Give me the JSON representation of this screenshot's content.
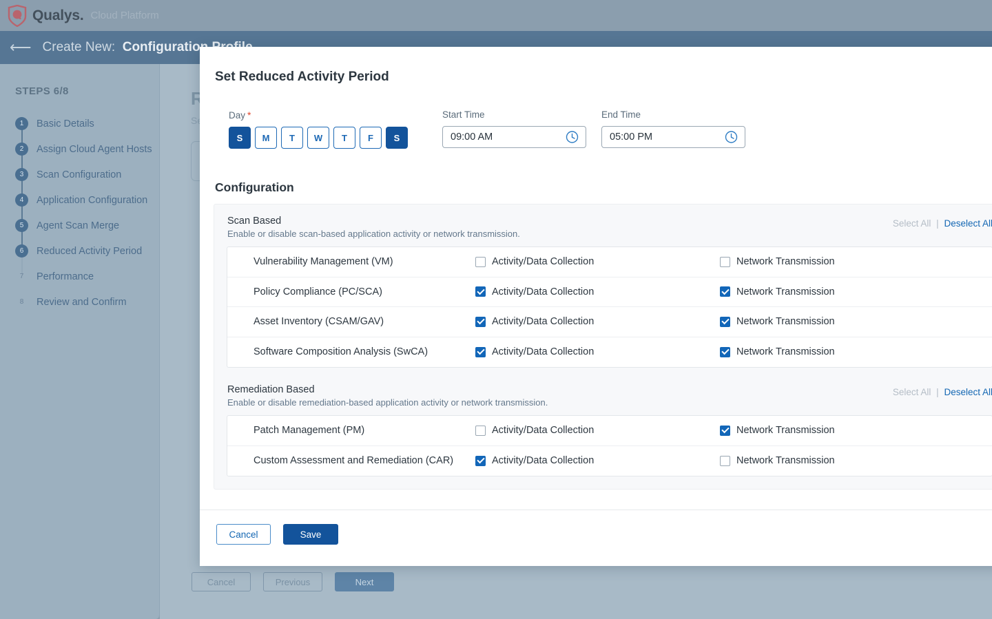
{
  "brand": {
    "name": "Qualys",
    "name_suffix": ".",
    "tagline": "Cloud Platform",
    "logo_icon": "qualys-shield-icon",
    "logo_color": "#b9646d"
  },
  "subheader": {
    "back_icon": "back-arrow-icon",
    "prefix": "Create New:",
    "title": "Configuration Profile"
  },
  "sidebar": {
    "steps_label": "STEPS 6/8",
    "items": [
      {
        "num": "1",
        "label": "Basic Details",
        "state": "done"
      },
      {
        "num": "2",
        "label": "Assign Cloud Agent Hosts",
        "state": "done"
      },
      {
        "num": "3",
        "label": "Scan Configuration",
        "state": "done"
      },
      {
        "num": "4",
        "label": "Application Configuration",
        "state": "done"
      },
      {
        "num": "5",
        "label": "Agent Scan Merge",
        "state": "done"
      },
      {
        "num": "6",
        "label": "Reduced Activity Period",
        "state": "current"
      },
      {
        "num": "7",
        "label": "Performance",
        "state": "pending"
      },
      {
        "num": "8",
        "label": "Review and Confirm",
        "state": "pending"
      }
    ]
  },
  "background_page": {
    "heading": "Reduced Activity Period",
    "subheading": "Set reduced activity periods for this profile.",
    "footer_buttons": [
      {
        "label": "Cancel",
        "style": "outline"
      },
      {
        "label": "Previous",
        "style": "outline"
      },
      {
        "label": "Next",
        "style": "primary"
      }
    ]
  },
  "modal": {
    "title": "Set Reduced Activity Period",
    "day_field": {
      "label": "Day",
      "required_marker": "*",
      "days": [
        {
          "label": "S",
          "selected": true
        },
        {
          "label": "M",
          "selected": false
        },
        {
          "label": "T",
          "selected": false
        },
        {
          "label": "W",
          "selected": false
        },
        {
          "label": "T",
          "selected": false
        },
        {
          "label": "F",
          "selected": false
        },
        {
          "label": "S",
          "selected": true
        }
      ]
    },
    "start_time": {
      "label": "Start Time",
      "value": "09:00 AM",
      "placeholder": "hh:mm AM",
      "icon": "clock-icon"
    },
    "end_time": {
      "label": "End Time",
      "value": "05:00 PM",
      "placeholder": "hh:mm PM",
      "icon": "clock-icon"
    },
    "configuration": {
      "title": "Configuration",
      "sections": [
        {
          "id": "scan-based",
          "title": "Scan Based",
          "description": "Enable or disable scan-based application activity or network transmission.",
          "select_all_label": "Select All",
          "separator": "|",
          "deselect_all_label": "Deselect All",
          "select_all_enabled": false,
          "deselect_all_enabled": true,
          "rows": [
            {
              "name": "Vulnerability Management (VM)",
              "activity_label": "Activity/Data Collection",
              "activity_checked": false,
              "network_label": "Network Transmission",
              "network_checked": false
            },
            {
              "name": "Policy Compliance (PC/SCA)",
              "activity_label": "Activity/Data Collection",
              "activity_checked": true,
              "network_label": "Network Transmission",
              "network_checked": true
            },
            {
              "name": "Asset Inventory (CSAM/GAV)",
              "activity_label": "Activity/Data Collection",
              "activity_checked": true,
              "network_label": "Network Transmission",
              "network_checked": true
            },
            {
              "name": "Software Composition Analysis (SwCA)",
              "activity_label": "Activity/Data Collection",
              "activity_checked": true,
              "network_label": "Network Transmission",
              "network_checked": true
            }
          ]
        },
        {
          "id": "remediation-based",
          "title": "Remediation Based",
          "description": "Enable or disable remediation-based application activity or network transmission.",
          "select_all_label": "Select All",
          "separator": "|",
          "deselect_all_label": "Deselect All",
          "select_all_enabled": false,
          "deselect_all_enabled": true,
          "rows": [
            {
              "name": "Patch Management (PM)",
              "activity_label": "Activity/Data Collection",
              "activity_checked": false,
              "network_label": "Network Transmission",
              "network_checked": true
            },
            {
              "name": "Custom Assessment and Remediation (CAR)",
              "activity_label": "Activity/Data Collection",
              "activity_checked": true,
              "network_label": "Network Transmission",
              "network_checked": false
            }
          ]
        }
      ]
    },
    "footer": {
      "cancel_label": "Cancel",
      "save_label": "Save"
    }
  },
  "colors": {
    "accent_blue": "#13539b",
    "checkbox_blue": "#1266b8",
    "link_blue": "#1467b3",
    "required_red": "#e0452b"
  }
}
